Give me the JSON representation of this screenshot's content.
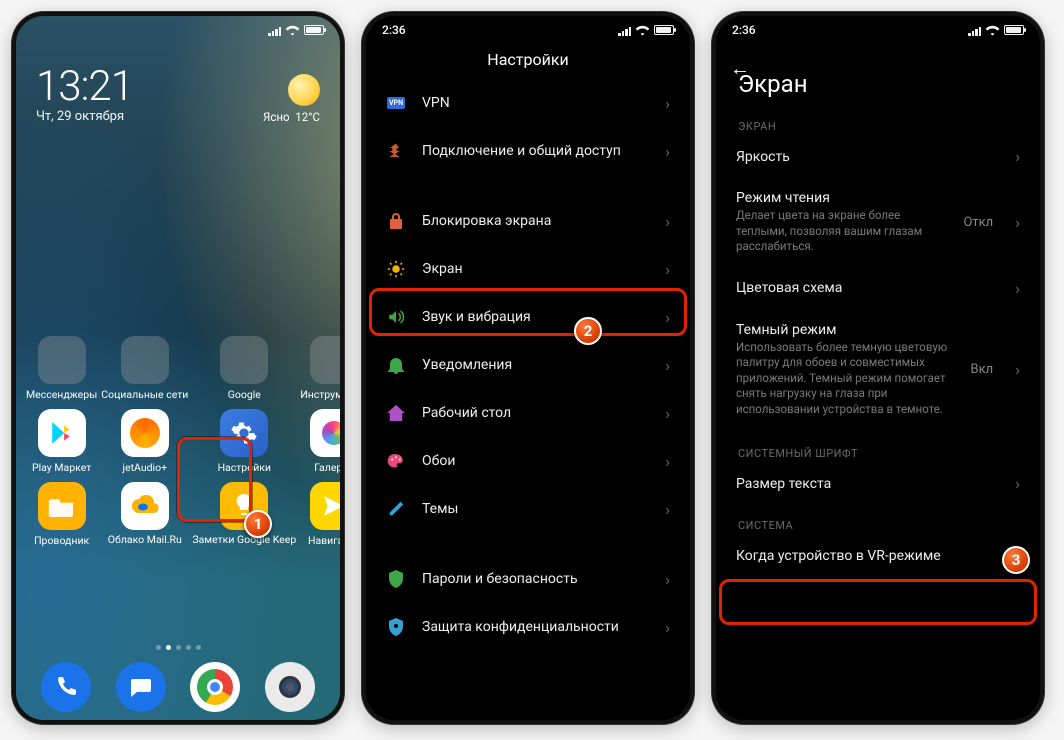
{
  "home": {
    "statusbar_time": "",
    "clock": "13:21",
    "date": "Чт, 29 октября",
    "weather_text": "Ясно",
    "weather_temp": "12°C",
    "folders": [
      "Мессенджеры",
      "Социальные сети",
      "Google",
      "Инструменты"
    ],
    "apps_row2": [
      "Play Маркет",
      "jetAudio+",
      "Настройки",
      "Галерея"
    ],
    "apps_row3": [
      "Проводник",
      "Облако Mail.Ru",
      "Заметки Google Keep",
      "Навигатор"
    ]
  },
  "settings": {
    "statusbar_time": "2:36",
    "title": "Настройки",
    "rows": [
      {
        "icon": "vpn",
        "label": "VPN"
      },
      {
        "icon": "share",
        "label": "Подключение и общий доступ"
      },
      {
        "icon": "lock",
        "label": "Блокировка экрана"
      },
      {
        "icon": "display",
        "label": "Экран"
      },
      {
        "icon": "sound",
        "label": "Звук и вибрация"
      },
      {
        "icon": "notif",
        "label": "Уведомления"
      },
      {
        "icon": "home",
        "label": "Рабочий стол"
      },
      {
        "icon": "wall",
        "label": "Обои"
      },
      {
        "icon": "theme",
        "label": "Темы"
      },
      {
        "icon": "sec",
        "label": "Пароли и безопасность"
      },
      {
        "icon": "privacy",
        "label": "Защита конфиденциальности"
      }
    ]
  },
  "display": {
    "statusbar_time": "2:36",
    "title": "Экран",
    "section1": "ЭКРАН",
    "brightness": "Яркость",
    "reading_title": "Режим чтения",
    "reading_sub": "Делает цвета на экране более теплыми, позволяя вашим глазам расслабиться.",
    "reading_val": "Откл",
    "color": "Цветовая схема",
    "dark_title": "Темный режим",
    "dark_sub": "Использовать более темную цветовую палитру для обоев и совместимых приложений. Темный режим помогает снять нагрузку на глаза при использовании устройства в темноте.",
    "dark_val": "Вкл",
    "section2": "СИСТЕМНЫЙ ШРИФТ",
    "textsize": "Размер текста",
    "section3": "СИСТЕМА",
    "vr": "Когда устройство в VR-режиме"
  },
  "callouts": {
    "one": "1",
    "two": "2",
    "three": "3"
  }
}
